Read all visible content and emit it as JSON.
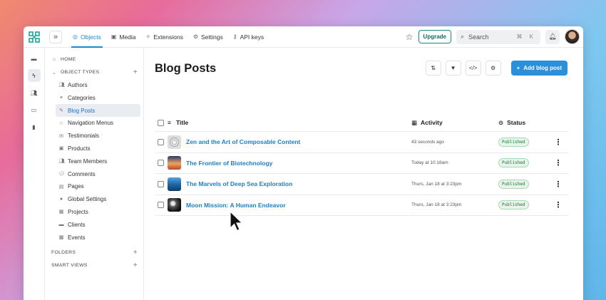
{
  "topbar": {
    "tabs": [
      {
        "label": "Objects",
        "icon": "objects-icon",
        "active": true
      },
      {
        "label": "Media",
        "icon": "media-icon",
        "active": false
      },
      {
        "label": "Extensions",
        "icon": "extensions-icon",
        "active": false
      },
      {
        "label": "Settings",
        "icon": "settings-icon",
        "active": false
      },
      {
        "label": "API keys",
        "icon": "key-icon",
        "active": false
      }
    ],
    "upgrade_label": "Upgrade",
    "search_placeholder": "Search",
    "search_shortcut": "⌘ K"
  },
  "sidebar": {
    "home_label": "HOME",
    "object_types_label": "OBJECT TYPES",
    "items": [
      {
        "label": "Authors",
        "icon": "people-icon"
      },
      {
        "label": "Categories",
        "icon": "link-icon"
      },
      {
        "label": "Blog Posts",
        "icon": "pencil-icon",
        "active": true
      },
      {
        "label": "Navigation Menus",
        "icon": "star-icon"
      },
      {
        "label": "Testimonials",
        "icon": "speech-icon"
      },
      {
        "label": "Products",
        "icon": "bag-icon"
      },
      {
        "label": "Team Members",
        "icon": "people-icon"
      },
      {
        "label": "Comments",
        "icon": "comment-icon"
      },
      {
        "label": "Pages",
        "icon": "page-icon"
      },
      {
        "label": "Global Settings",
        "icon": "globe-icon"
      },
      {
        "label": "Projects",
        "icon": "projects-icon"
      },
      {
        "label": "Clients",
        "icon": "briefcase-icon"
      },
      {
        "label": "Events",
        "icon": "calendar-icon"
      }
    ],
    "folders_label": "FOLDERS",
    "smart_views_label": "SMART VIEWS"
  },
  "main": {
    "title": "Blog Posts",
    "add_button_label": "Add blog post",
    "columns": {
      "title": "Title",
      "activity": "Activity",
      "status": "Status"
    },
    "rows": [
      {
        "title": "Zen and the Art of Composable Content",
        "activity": "43 seconds ago",
        "status": "Published"
      },
      {
        "title": "The Frontier of Biotechnology",
        "activity": "Today at 10:18am",
        "status": "Published"
      },
      {
        "title": "The Marvels of Deep Sea Exploration",
        "activity": "Thurs, Jan 18 at 3:23pm",
        "status": "Published"
      },
      {
        "title": "Moon Mission: A Human Endeavor",
        "activity": "Thurs, Jan 18 at 3:23pm",
        "status": "Published"
      }
    ]
  },
  "colors": {
    "accent": "#1a8bd0",
    "button": "#2b8fd9",
    "published": "#2a6b3a"
  }
}
